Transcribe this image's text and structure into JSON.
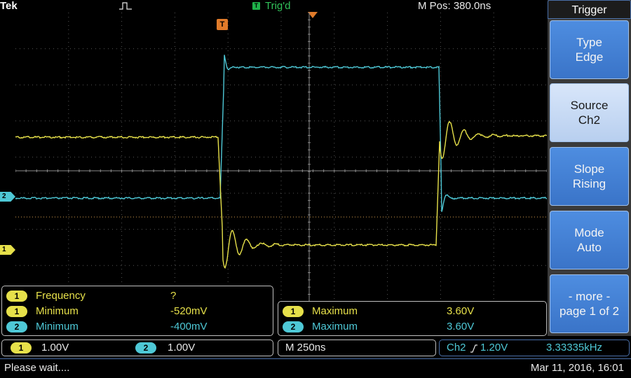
{
  "top": {
    "brand": "Tek",
    "trig_badge": "T",
    "trig_status": "Trig'd",
    "mpos": "M Pos: 380.0ns"
  },
  "markers": {
    "ch2": "2",
    "ch1": "1",
    "trigger": "T"
  },
  "measurements": {
    "left": [
      {
        "ch": "1",
        "label": "Frequency",
        "value": "?",
        "color": "yellow"
      },
      {
        "ch": "1",
        "label": "Minimum",
        "value": "-520mV",
        "color": "yellow"
      },
      {
        "ch": "2",
        "label": "Minimum",
        "value": "-400mV",
        "color": "cyan"
      }
    ],
    "right": [
      {
        "ch": "1",
        "label": "Maximum",
        "value": "3.60V",
        "color": "yellow"
      },
      {
        "ch": "2",
        "label": "Maximum",
        "value": "3.60V",
        "color": "cyan"
      }
    ]
  },
  "readouts": {
    "ch1_badge": "1",
    "ch1_scale": "1.00V",
    "ch2_badge": "2",
    "ch2_scale": "1.00V",
    "timebase": "M 250ns",
    "trigger_source": "Ch2",
    "trigger_slope_icon": "rising-edge-icon",
    "trigger_level": "1.20V",
    "trigger_freq": "3.33335kHz"
  },
  "menu": {
    "title": "Trigger",
    "buttons": [
      {
        "line1": "Type",
        "line2": "Edge"
      },
      {
        "line1": "Source",
        "line2": "Ch2"
      },
      {
        "line1": "Slope",
        "line2": "Rising"
      },
      {
        "line1": "Mode",
        "line2": "Auto"
      },
      {
        "line1": "- more -",
        "line2": "page 1 of 2"
      }
    ]
  },
  "status": {
    "message": "Please wait....",
    "datetime": "Mar 11, 2016, 16:01"
  },
  "colors": {
    "ch1": "#e6e04a",
    "ch2": "#4ec8d6",
    "trigger": "#e07b2a",
    "menu_blue": "#3a74c8"
  }
}
